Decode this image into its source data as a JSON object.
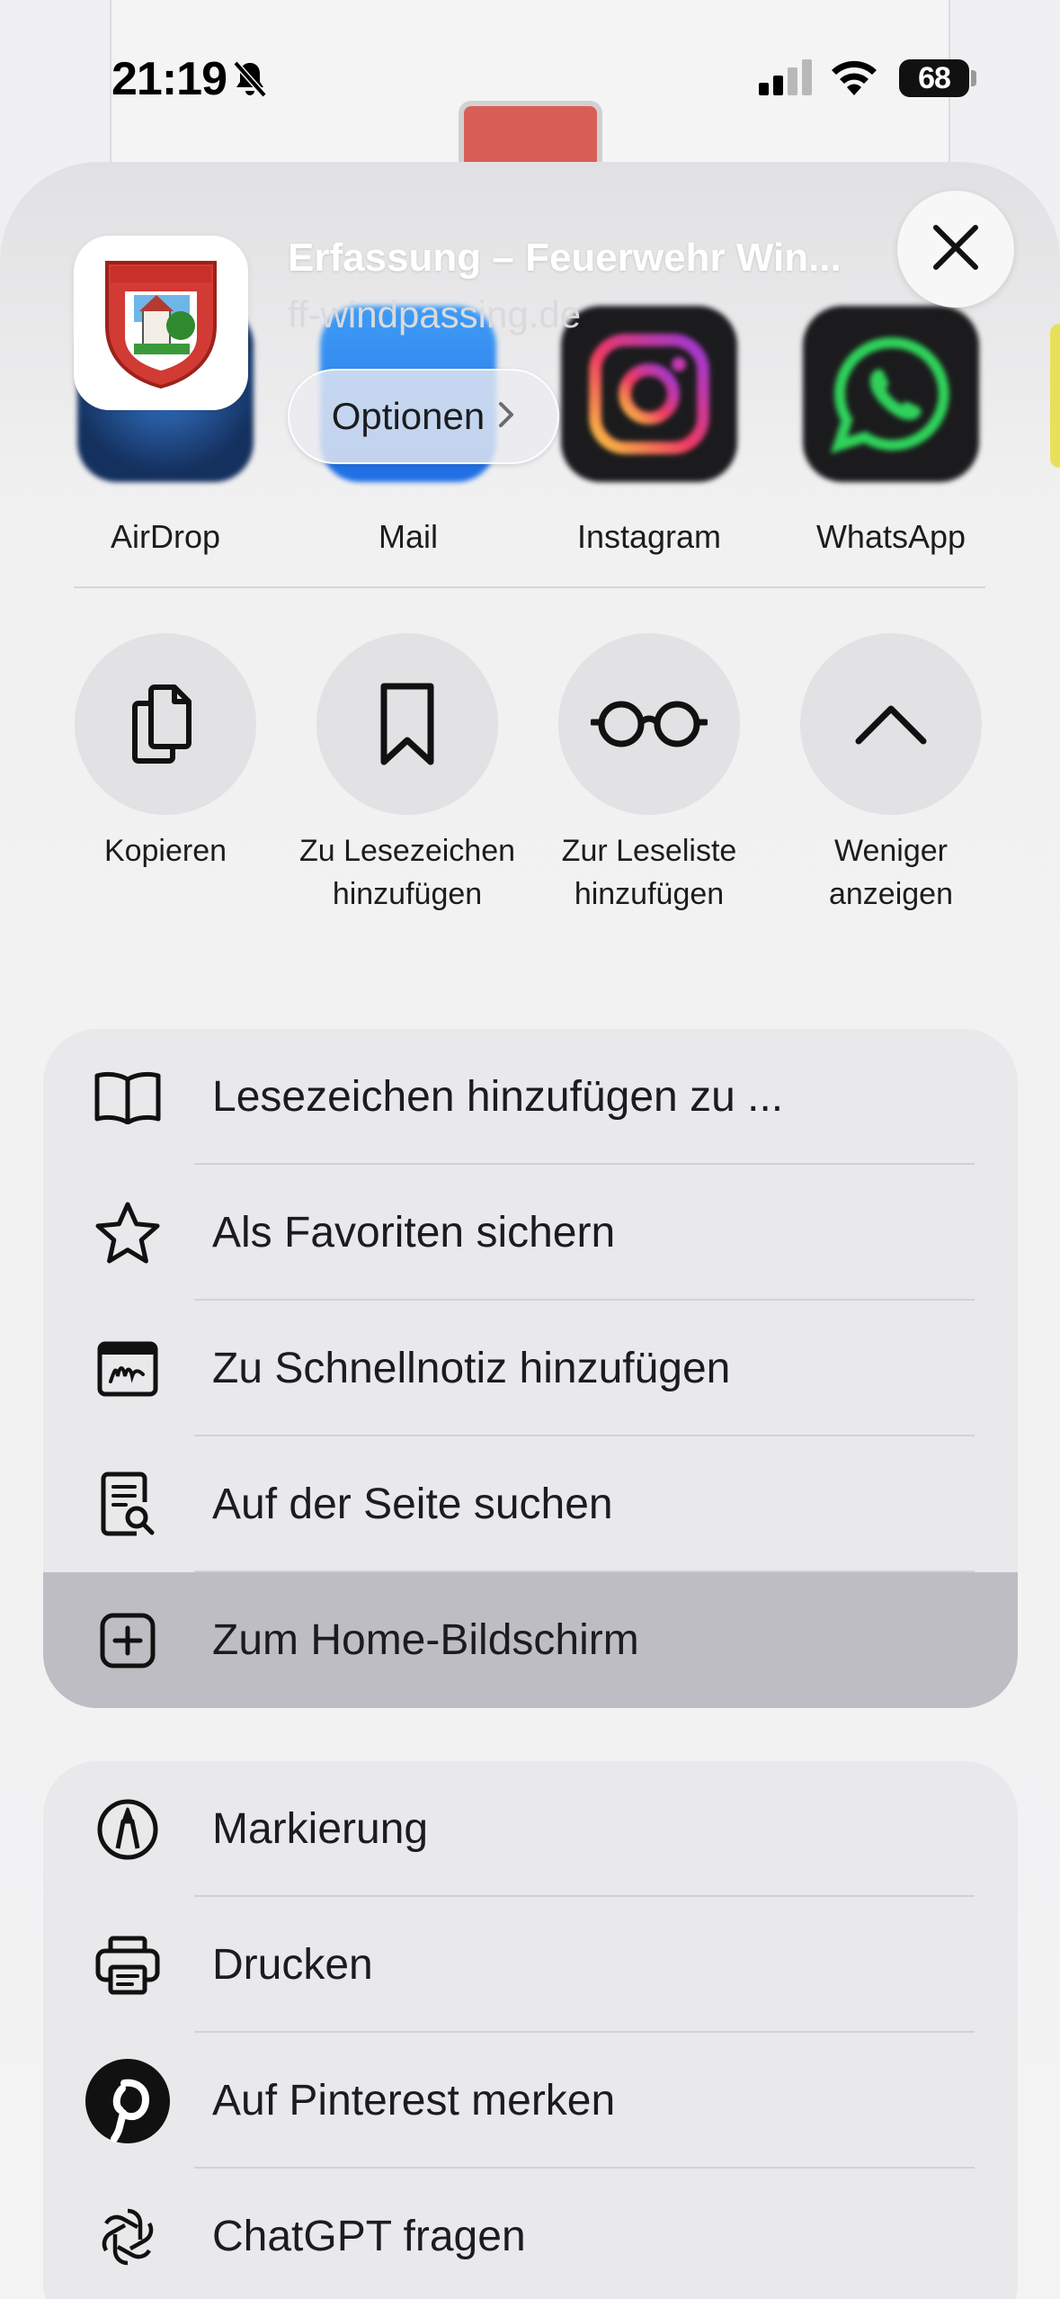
{
  "status_bar": {
    "time": "21:19",
    "battery": "68"
  },
  "share_header": {
    "title": "Erfassung – Feuerwehr Win...",
    "url": "ff-windpassing.de",
    "options_label": "Optionen"
  },
  "apps": [
    {
      "label": "AirDrop",
      "icon": "airdrop-icon"
    },
    {
      "label": "Mail",
      "icon": "mail-icon"
    },
    {
      "label": "Instagram",
      "icon": "instagram-icon"
    },
    {
      "label": "WhatsApp",
      "icon": "whatsapp-icon"
    }
  ],
  "actions": [
    {
      "label": "Kopieren",
      "icon": "copy-icon"
    },
    {
      "label": "Zu Lesezeichen hinzufügen",
      "icon": "bookmark-icon"
    },
    {
      "label": "Zur Leseliste hinzufügen",
      "icon": "glasses-icon"
    },
    {
      "label": "Weniger anzeigen",
      "icon": "chevron-up-icon"
    }
  ],
  "menu_group_1": [
    {
      "label": "Lesezeichen hinzufügen zu ...",
      "icon": "book-icon"
    },
    {
      "label": "Als Favoriten sichern",
      "icon": "star-icon"
    },
    {
      "label": "Zu Schnellnotiz hinzufügen",
      "icon": "quick-note-icon"
    },
    {
      "label": "Auf der Seite suchen",
      "icon": "find-on-page-icon"
    },
    {
      "label": "Zum Home-Bildschirm",
      "icon": "add-square-icon",
      "highlighted": true
    }
  ],
  "menu_group_2": [
    {
      "label": "Markierung",
      "icon": "markup-icon"
    },
    {
      "label": "Drucken",
      "icon": "printer-icon"
    },
    {
      "label": "Auf Pinterest merken",
      "icon": "pinterest-icon"
    },
    {
      "label": "ChatGPT fragen",
      "icon": "chatgpt-icon"
    }
  ],
  "colors": {
    "accent_highlight": "#bebdc4",
    "sheet_bg": "#f1f1f2",
    "row_bg": "#e9e9eb"
  }
}
